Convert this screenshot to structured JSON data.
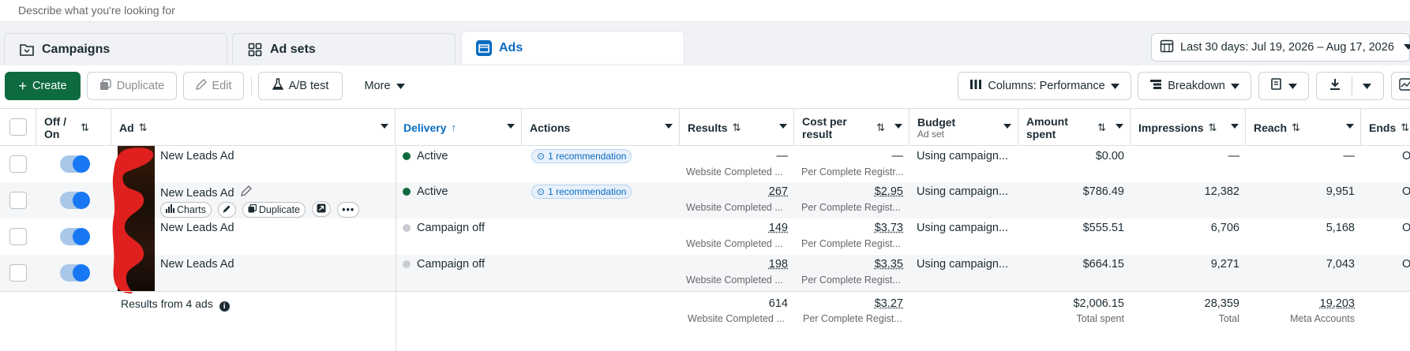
{
  "search": {
    "placeholder": "Describe what you're looking for"
  },
  "tabs": [
    {
      "label": "Campaigns",
      "icon": "folder-icon",
      "active": false
    },
    {
      "label": "Ad sets",
      "icon": "grid-icon",
      "active": false
    },
    {
      "label": "Ads",
      "icon": "ad-icon",
      "active": true
    }
  ],
  "date_range": {
    "label": "Last 30 days: Jul 19, 2026 – Aug 17, 2026"
  },
  "toolbar": {
    "create": "Create",
    "duplicate": "Duplicate",
    "edit": "Edit",
    "ab_test": "A/B test",
    "more": "More",
    "columns": "Columns: Performance",
    "breakdown": "Breakdown"
  },
  "columns": {
    "off_on": "Off / On",
    "ad": "Ad",
    "delivery": "Delivery",
    "actions": "Actions",
    "results": "Results",
    "cost_per_result": "Cost per result",
    "budget": "Budget",
    "budget_sub": "Ad set",
    "amount_spent": "Amount spent",
    "impressions": "Impressions",
    "reach": "Reach",
    "ends": "Ends"
  },
  "rows": [
    {
      "name": "New Leads Ad",
      "delivery": "Active",
      "delivery_color": "#0e6b3f",
      "recommendation": "1 recommendation",
      "results": "—",
      "results_sub": "Website Completed ...",
      "cost": "—",
      "cost_sub": "Per Complete Registr...",
      "budget": "Using campaign...",
      "spent": "$0.00",
      "impressions": "—",
      "reach": "—",
      "ends": "O"
    },
    {
      "name": "New Leads Ad",
      "delivery": "Active",
      "delivery_color": "#0e6b3f",
      "recommendation": "1 recommendation",
      "results": "267",
      "results_sub": "Website Completed ...",
      "cost": "$2.95",
      "cost_sub": "Per Complete Regist...",
      "budget": "Using campaign...",
      "spent": "$786.49",
      "impressions": "12,382",
      "reach": "9,951",
      "ends": "O",
      "hover": {
        "charts": "Charts",
        "duplicate": "Duplicate"
      }
    },
    {
      "name": "New Leads Ad",
      "delivery": "Campaign off",
      "delivery_color": "#c9ccd1",
      "recommendation": "",
      "results": "149",
      "results_sub": "Website Completed ...",
      "cost": "$3.73",
      "cost_sub": "Per Complete Regist...",
      "budget": "Using campaign...",
      "spent": "$555.51",
      "impressions": "6,706",
      "reach": "5,168",
      "ends": "O"
    },
    {
      "name": "New Leads Ad",
      "delivery": "Campaign off",
      "delivery_color": "#c9ccd1",
      "recommendation": "",
      "results": "198",
      "results_sub": "Website Completed ...",
      "cost": "$3.35",
      "cost_sub": "Per Complete Regist...",
      "budget": "Using campaign...",
      "spent": "$664.15",
      "impressions": "9,271",
      "reach": "7,043",
      "ends": "O"
    }
  ],
  "totals": {
    "label": "Results from 4 ads",
    "results": "614",
    "results_sub": "Website Completed ...",
    "cost": "$3.27",
    "cost_sub": "Per Complete Regist...",
    "spent": "$2,006.15",
    "spent_sub": "Total spent",
    "impressions": "28,359",
    "impressions_sub": "Total",
    "reach": "19,203",
    "reach_sub": "Meta Accounts"
  }
}
